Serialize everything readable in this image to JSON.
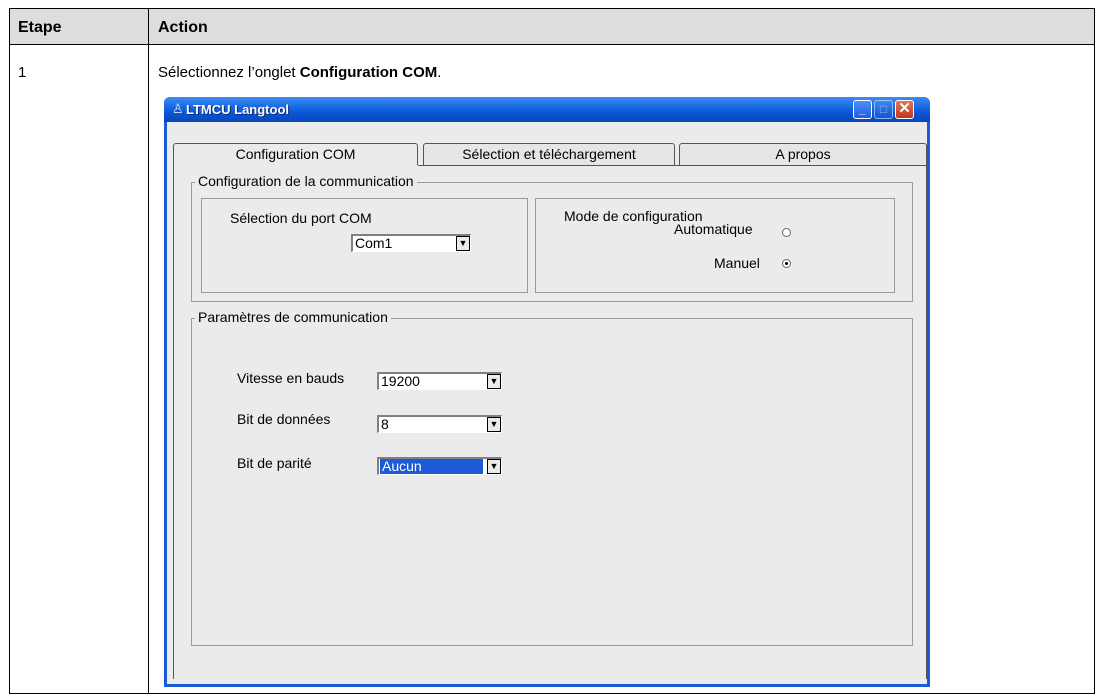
{
  "table": {
    "col_step": "Etape",
    "col_action": "Action",
    "step_number": "1",
    "instruction_prefix": "Sélectionnez l’onglet ",
    "instruction_bold": "Configuration COM",
    "instruction_suffix": "."
  },
  "window": {
    "title": "LTMCU Langtool",
    "tabs": [
      "Configuration COM",
      "Sélection et téléchargement",
      "A propos"
    ],
    "active_tab": "Configuration COM"
  },
  "comm_config": {
    "group_title": "Configuration de la communication",
    "port_label": "Sélection du port COM",
    "port_value": "Com1",
    "mode_label": "Mode de configuration",
    "mode_auto": "Automatique",
    "mode_manual": "Manuel",
    "mode_selected": "Manuel"
  },
  "comm_params": {
    "group_title": "Paramètres de communication",
    "baud_label": "Vitesse en bauds",
    "baud_value": "19200",
    "data_bits_label": "Bit de données",
    "data_bits_value": "8",
    "parity_label": "Bit de parité",
    "parity_value": "Aucun"
  },
  "colors": {
    "titlebar": "#0a58d8",
    "selection": "#1c5ad6",
    "close_button": "#c4361b"
  }
}
